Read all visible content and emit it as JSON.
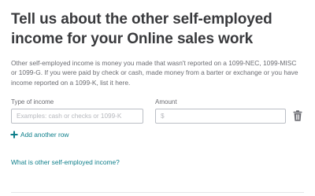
{
  "heading": {
    "title": "Tell us about the other self-employed income for your Online sales work"
  },
  "description": "Other self-employed income is money you made that wasn't reported on a 1099-NEC, 1099-MISC or 1099-G. If you were paid by check or cash, made money from a barter or exchange or you have income reported on a 1099-K, list it here.",
  "form": {
    "type_label": "Type of income",
    "type_value": "",
    "type_placeholder": "Examples: cash or checks or 1099-K",
    "amount_label": "Amount",
    "amount_value": "",
    "amount_placeholder": "$",
    "delete_icon": "trash-icon"
  },
  "actions": {
    "add_row_label": "Add another row",
    "add_row_icon": "plus-icon"
  },
  "help": {
    "link_label": "What is other self-employed income?"
  },
  "colors": {
    "heading": "#393a3d",
    "body_text": "#6b6c72",
    "link": "#0d7e8a",
    "input_border": "#babec5"
  }
}
